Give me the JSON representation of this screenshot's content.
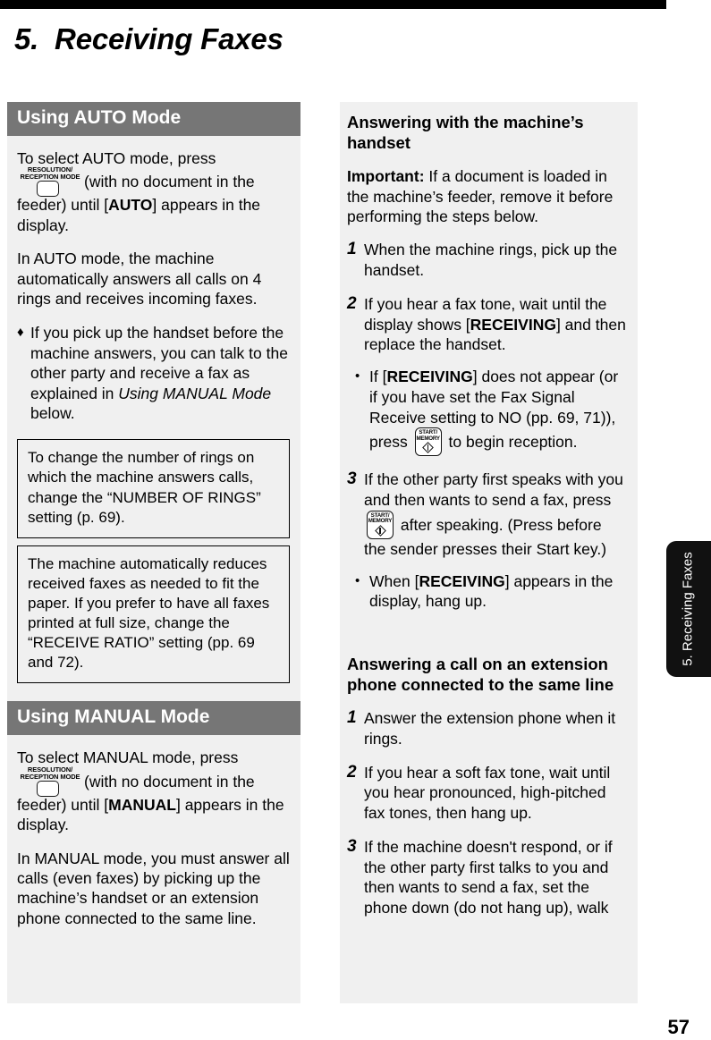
{
  "page": {
    "chapter_title": "5.  Receiving Faxes",
    "page_number": "57",
    "side_tab_label": "5. Receiving\nFaxes",
    "colors": {
      "section_bar": "#767676",
      "panel_background": "#f0f0f0",
      "side_tab": "#111111",
      "rule": "#000000"
    }
  },
  "icons": {
    "resolution_key": {
      "name": "resolution-reception-mode-key",
      "caption": "RESOLUTION/\nRECEPTION MODE"
    },
    "start_key": {
      "name": "start-memory-key",
      "caption": "START/\nMEMORY"
    }
  },
  "left_column": {
    "auto": {
      "heading": "Using AUTO Mode",
      "intro_before_key": "To select AUTO mode, press",
      "intro_after_key_1": "(with no document in the feeder) until [",
      "intro_bold": "AUTO",
      "intro_after_key_2": "] appears in the display.",
      "para2": "In AUTO  mode, the machine automatically answers all calls on 4 rings and receives incoming faxes.",
      "bullet_mark": "♦",
      "bullet_part1": "If you pick up the handset before the machine answers, you can talk to the other party and receive a fax as explained in ",
      "bullet_italic": "Using MANUAL Mode",
      "bullet_part2": " below.",
      "note1": "To change the number of rings on which the machine answers calls, change the “NUMBER OF RINGS” setting (p. 69).",
      "note2": "The machine automatically reduces received faxes as needed to fit the paper. If you prefer to have all faxes printed at full size, change the “RECEIVE RATIO” setting (pp. 69 and 72)."
    },
    "manual": {
      "heading": "Using MANUAL Mode",
      "intro_before_key": "To select MANUAL mode, press",
      "intro_after_key_1": "(with no document in the feeder) until [",
      "intro_bold": "MANUAL",
      "intro_after_key_2": "] appears in the display.",
      "para2": "In MANUAL mode, you must answer all calls (even faxes) by picking up the machine’s handset or an extension phone connected to the same line."
    }
  },
  "right_column": {
    "handset_section": {
      "heading": "Answering with the machine’s handset",
      "important_label": "Important:",
      "important_text": " If a document is loaded in the machine’s feeder, remove it before performing the steps below.",
      "steps": [
        {
          "number": "1",
          "text": "When the machine rings, pick up the handset."
        },
        {
          "number": "2",
          "text_part1": "If you hear a fax tone, wait until the display shows [",
          "bold": "RECEIVING",
          "text_part2": "] and then replace the handset."
        },
        {
          "number": "3",
          "text_part1": "If the other party first speaks with you and then wants to send a fax, press ",
          "text_part2": " after speaking. (Press before the sender presses their Start key.)"
        }
      ],
      "sub_bullets": [
        {
          "mark": "•",
          "text_part1": "If [",
          "bold": "RECEIVING",
          "text_part2": "] does not appear (or if you have set the Fax Signal Receive setting to NO (pp. 69, 71)), press ",
          "text_part3": " to begin reception."
        },
        {
          "mark": "•",
          "text_part1": "When [",
          "bold": "RECEIVING",
          "text_part2": "] appears in the display, hang up."
        }
      ]
    },
    "extension_section": {
      "heading": "Answering a call on an extension phone connected to the same line",
      "steps": [
        {
          "number": "1",
          "text": "Answer the extension phone when it rings."
        },
        {
          "number": "2",
          "text": "If you hear a soft fax tone, wait until you hear pronounced, high-pitched fax tones, then hang up."
        },
        {
          "number": "3",
          "text": "If the machine doesn't respond, or if the other party first talks to you and then wants to send a fax, set the phone down (do not hang up), walk"
        }
      ]
    }
  }
}
